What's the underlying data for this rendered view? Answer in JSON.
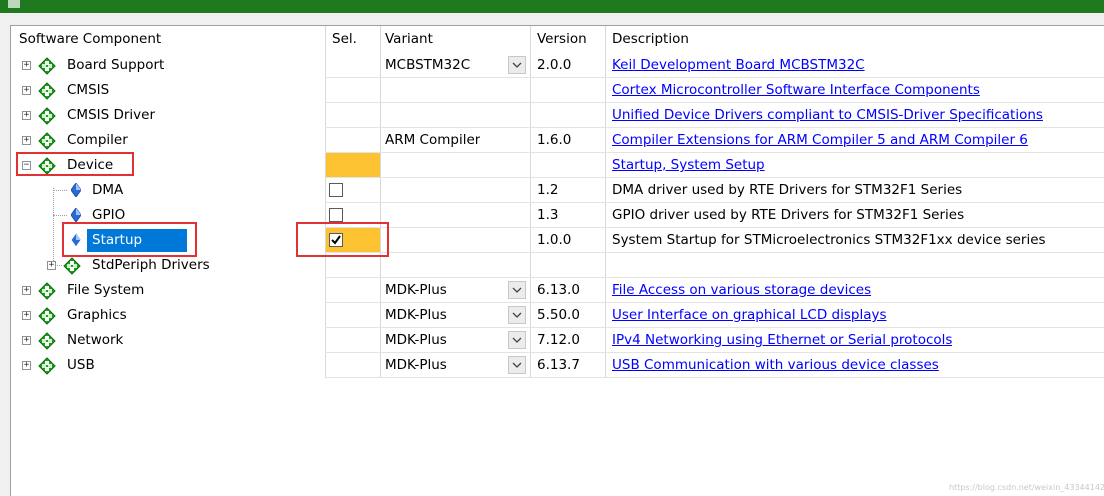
{
  "colors": {
    "accent_select": "#0078d7",
    "yellow_sel": "#fdc232",
    "link": "#0000ff",
    "green_icon": "#18a418",
    "highlight_box": "#e03232"
  },
  "headers": {
    "component": "Software Component",
    "sel": "Sel.",
    "variant": "Variant",
    "version": "Version",
    "description": "Description"
  },
  "rows": [
    {
      "name": "Board Support",
      "variant": "MCBSTM32C",
      "version": "2.0.0",
      "description": "Keil Development Board MCBSTM32C",
      "link": true,
      "combo": true
    },
    {
      "name": "CMSIS",
      "variant": "",
      "version": "",
      "description": "Cortex Microcontroller Software Interface Components",
      "link": true
    },
    {
      "name": "CMSIS Driver",
      "variant": "",
      "version": "",
      "description": "Unified Device Drivers compliant to CMSIS-Driver Specifications",
      "link": true
    },
    {
      "name": "Compiler",
      "variant": "ARM Compiler",
      "version": "1.6.0",
      "description": "Compiler Extensions for ARM Compiler 5 and ARM Compiler 6",
      "link": true
    },
    {
      "name": "Device",
      "variant": "",
      "version": "",
      "description": "Startup, System Setup",
      "link": true
    },
    {
      "name": "DMA",
      "variant": "",
      "version": "1.2",
      "description": "DMA driver used by RTE Drivers for STM32F1 Series",
      "link": false
    },
    {
      "name": "GPIO",
      "variant": "",
      "version": "1.3",
      "description": "GPIO driver used by RTE Drivers for STM32F1 Series",
      "link": false
    },
    {
      "name": "Startup",
      "variant": "",
      "version": "1.0.0",
      "description": "System Startup for STMicroelectronics STM32F1xx device series",
      "link": false,
      "checked": true
    },
    {
      "name": "StdPeriph Drivers",
      "variant": "",
      "version": "",
      "description": "",
      "link": false
    },
    {
      "name": "File System",
      "variant": "MDK-Plus",
      "version": "6.13.0",
      "description": "File Access on various storage devices",
      "link": true,
      "combo": true
    },
    {
      "name": "Graphics",
      "variant": "MDK-Plus",
      "version": "5.50.0",
      "description": "User Interface on graphical LCD displays",
      "link": true,
      "combo": true
    },
    {
      "name": "Network",
      "variant": "MDK-Plus",
      "version": "7.12.0",
      "description": "IPv4 Networking using Ethernet or Serial protocols",
      "link": true,
      "combo": true
    },
    {
      "name": "USB",
      "variant": "MDK-Plus",
      "version": "6.13.7",
      "description": "USB Communication with various device classes",
      "link": true,
      "combo": true
    }
  ],
  "watermark": "https://blog.csdn.net/weixin_43344142"
}
